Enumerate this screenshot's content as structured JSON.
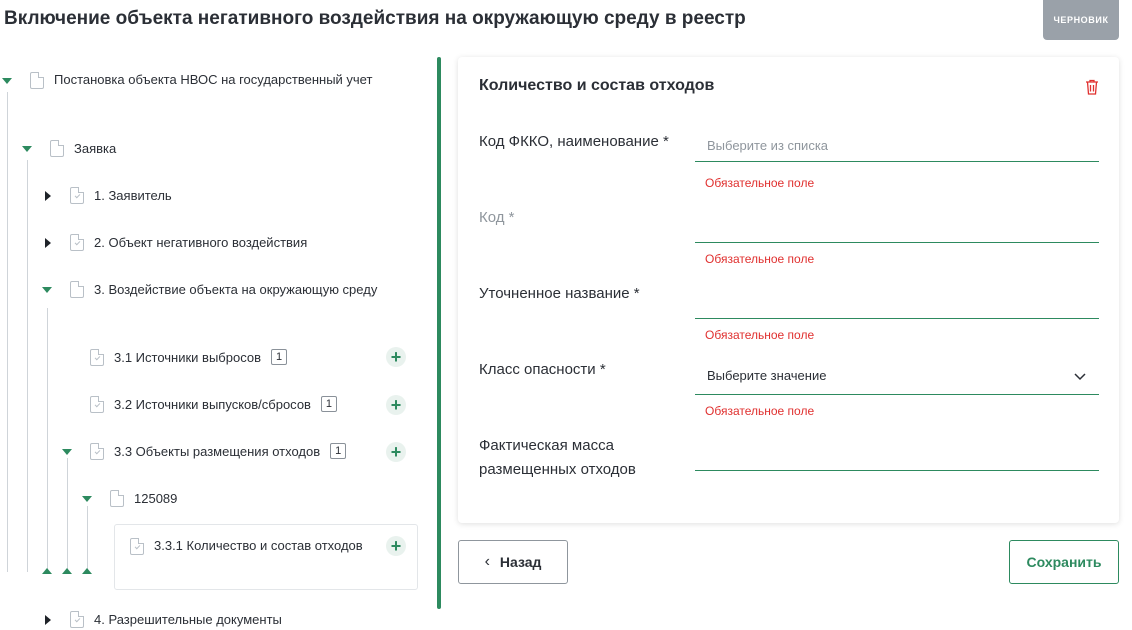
{
  "page": {
    "title": "Включение объекта негативного воздействия на окружающую среду в реестр",
    "status_badge": "ЧЕРНОВИК"
  },
  "tree": {
    "root": "Постановка объекта НВОС на государственный учет",
    "application": "Заявка",
    "applicant": "1. Заявитель",
    "object": "2. Объект негативного воздействия",
    "impact": "3. Воздействие объекта на окружающую среду",
    "emission_sources": {
      "label": "3.1 Источники выбросов",
      "count": "1"
    },
    "discharge_sources": {
      "label": "3.2 Источники выпусков/сбросов",
      "count": "1"
    },
    "waste_objects": {
      "label": "3.3 Объекты размещения отходов",
      "count": "1"
    },
    "object_id": "125089",
    "waste_amount": "3.3.1 Количество и состав отходов",
    "permits": "4. Разрешительные документы"
  },
  "form": {
    "title": "Количество и состав отходов",
    "fkko_label": "Код ФККО, наименование *",
    "fkko_placeholder": "Выберите из списка",
    "code_label": "Код *",
    "name_label": "Уточненное название *",
    "hazard_label": "Класс опасности *",
    "hazard_value": "Выберите значение",
    "mass_label": "Фактическая масса размещенных отходов",
    "required_error": "Обязательное поле"
  },
  "actions": {
    "back": "Назад",
    "save": "Сохранить"
  },
  "colors": {
    "accent": "#2d8a5f",
    "error": "#e0302f",
    "badge": "#9aa1a9"
  }
}
